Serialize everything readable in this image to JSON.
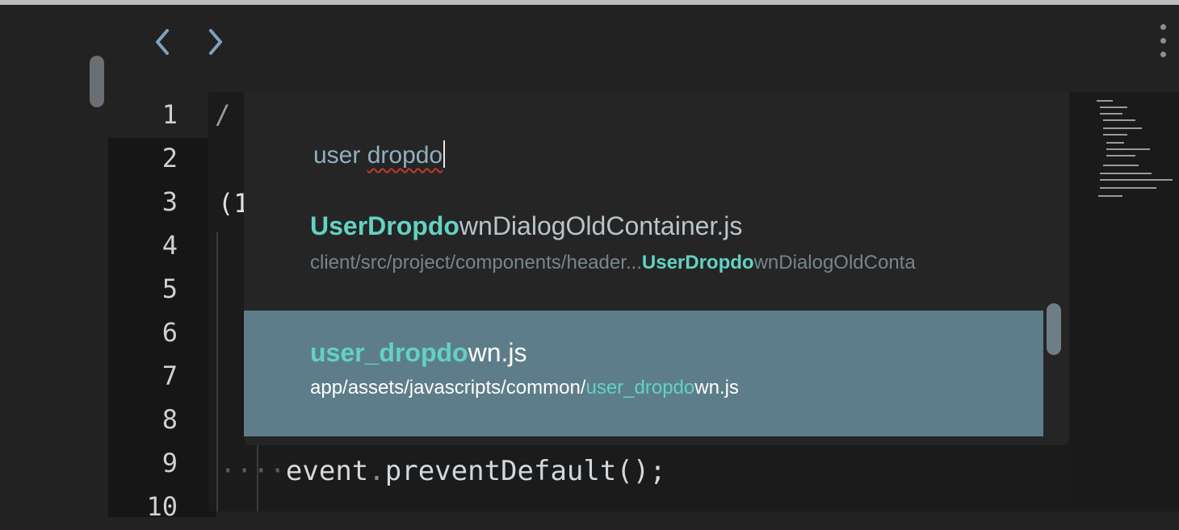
{
  "nav": {
    "back_icon": "chevron-left-icon",
    "forward_icon": "chevron-right-icon",
    "more_icon": "vertical-ellipsis-icon"
  },
  "editor": {
    "line_numbers": [
      "1",
      "2",
      "3",
      "4",
      "5",
      "6",
      "7",
      "8",
      "9",
      "10"
    ],
    "fragments": {
      "line1": "/",
      "line3": "(1"
    },
    "line9": {
      "indent": "···",
      "lead_dot": "·",
      "object": "event",
      "dot": ".",
      "method": "preventDefault",
      "end": "();"
    }
  },
  "palette": {
    "query_word": "user",
    "query_term": "dropdo",
    "results": [
      {
        "title_match": "UserDropdo",
        "title_rest": "wnDialogOldContainer.js",
        "path_prefix": "client/src/project/components/header...",
        "path_match": "UserDropdo",
        "path_rest": "wnDialogOldConta",
        "selected": false
      },
      {
        "title_match": "user_dropdo",
        "title_rest": "wn.js",
        "path_prefix": "app/assets/javascripts/common/",
        "path_match": "user_dropdo",
        "path_rest": "wn.js",
        "selected": true
      }
    ]
  },
  "colors": {
    "match": "#62d2c2",
    "selected_row": "#5e7d8a",
    "background": "#222222"
  }
}
